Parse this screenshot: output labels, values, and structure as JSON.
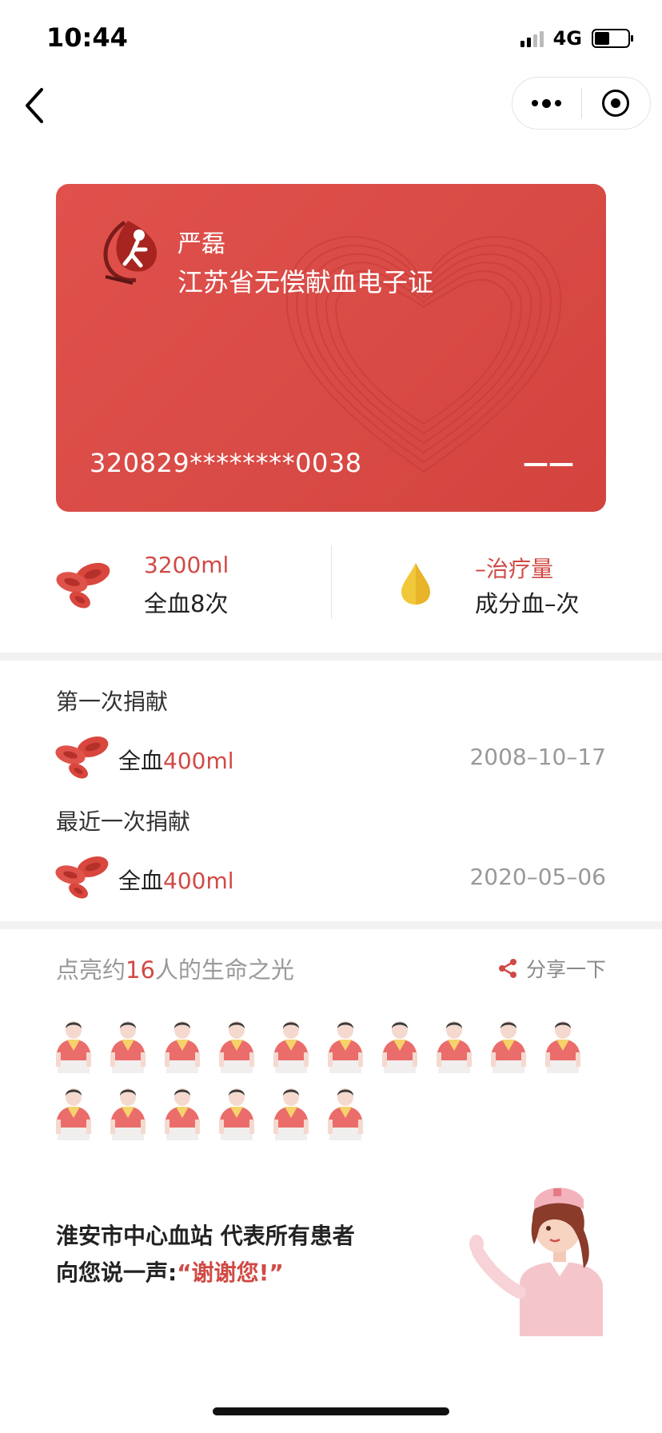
{
  "status_bar": {
    "time": "10:44",
    "network": "4G",
    "battery_fraction": 0.45,
    "signal_bars": 4,
    "signal_bars_filled": 2
  },
  "nav": {
    "back_icon": "chevron-left-icon",
    "more_icon": "more-dots-icon",
    "close_icon": "target-icon"
  },
  "card": {
    "name": "严磊",
    "title": "江苏省无偿献血电子证",
    "id_number": "320829********0038",
    "blood_type": "——",
    "color": "#db4a45"
  },
  "stats": {
    "whole_blood_volume": "3200ml",
    "whole_blood_label": "全血8次",
    "component_volume": "–治疗量",
    "component_label": "成分血–次"
  },
  "donations": [
    {
      "heading": "第一次捐献",
      "type": "全血",
      "amount": "400ml",
      "date": "2008–10–17"
    },
    {
      "heading": "最近一次捐献",
      "type": "全血",
      "amount": "400ml",
      "date": "2020–05–06"
    }
  ],
  "light": {
    "prefix": "点亮约",
    "count": "16",
    "suffix": "人的生命之光",
    "share_label": "分享一下",
    "people_count": 16
  },
  "thanks": {
    "line1": "淮安市中心血站 代表所有患者",
    "line2_prefix": "向您说一声:",
    "line2_quote": "“谢谢您!”"
  },
  "colors": {
    "accent": "#d04a45",
    "card": "#db4a45",
    "muted": "#999999"
  }
}
